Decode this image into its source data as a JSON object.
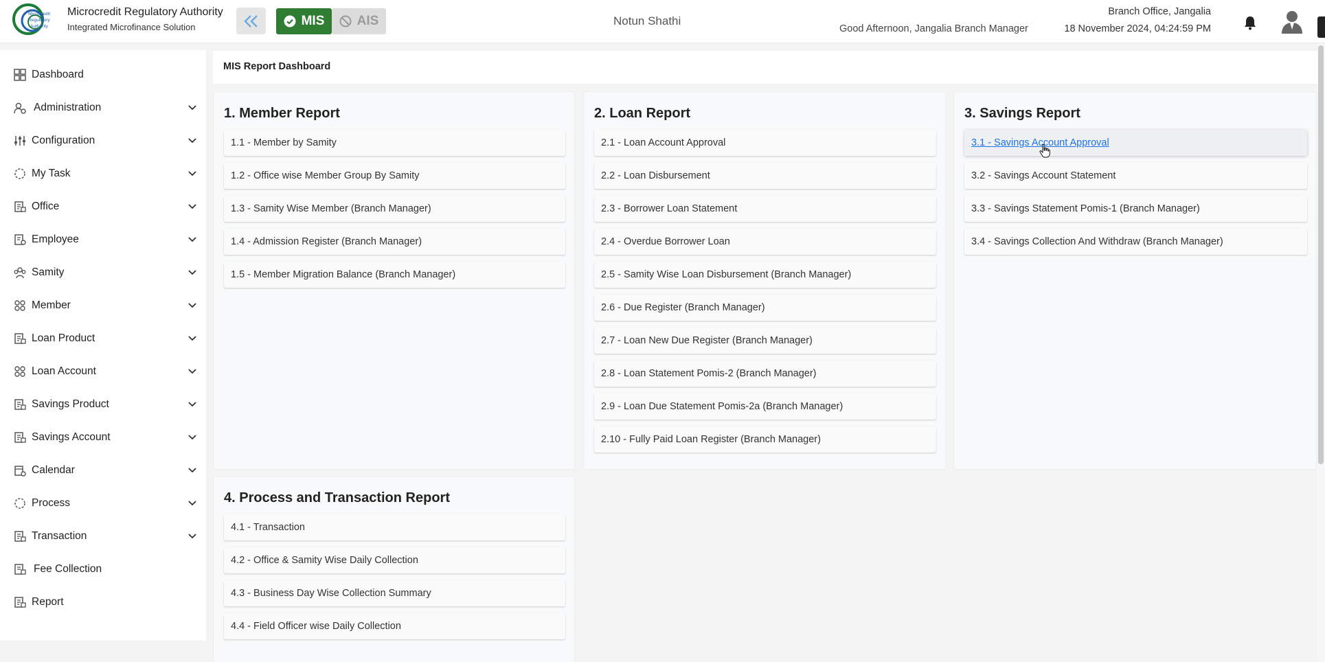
{
  "header": {
    "brand_title": "Microcredit Regulatory Authority",
    "brand_subtitle": "Integrated Microfinance Solution",
    "logo_text": "Microcredit Regulatory Authority",
    "mis_label": "MIS",
    "ais_label": "AIS",
    "org_name": "Notun Shathi",
    "greeting": "Good Afternoon, Jangalia Branch Manager",
    "branch": "Branch Office, Jangalia",
    "datetime": "18 November 2024, 04:24:59 PM"
  },
  "colors": {
    "mis_green": "#2e7d32",
    "link_blue": "#1a73e8",
    "logo_green": "#1b7c3a",
    "logo_blue": "#1f5fae"
  },
  "sidebar": {
    "items": [
      {
        "label": "Dashboard",
        "icon": "dashboard-icon",
        "expandable": false
      },
      {
        "label": "Administration",
        "icon": "admin-icon",
        "expandable": true
      },
      {
        "label": "Configuration",
        "icon": "sliders-icon",
        "expandable": true
      },
      {
        "label": "My Task",
        "icon": "task-icon",
        "expandable": true
      },
      {
        "label": "Office",
        "icon": "office-icon",
        "expandable": true
      },
      {
        "label": "Employee",
        "icon": "employee-icon",
        "expandable": true
      },
      {
        "label": "Samity",
        "icon": "samity-icon",
        "expandable": true
      },
      {
        "label": "Member",
        "icon": "member-icon",
        "expandable": true
      },
      {
        "label": "Loan Product",
        "icon": "loan-product-icon",
        "expandable": true
      },
      {
        "label": "Loan Account",
        "icon": "loan-account-icon",
        "expandable": true
      },
      {
        "label": "Savings Product",
        "icon": "savings-product-icon",
        "expandable": true
      },
      {
        "label": "Savings Account",
        "icon": "savings-account-icon",
        "expandable": true
      },
      {
        "label": "Calendar",
        "icon": "calendar-icon",
        "expandable": true
      },
      {
        "label": "Process",
        "icon": "process-icon",
        "expandable": true
      },
      {
        "label": "Transaction",
        "icon": "transaction-icon",
        "expandable": true
      },
      {
        "label": "Fee Collection",
        "icon": "fee-collection-icon",
        "expandable": false
      },
      {
        "label": "Report",
        "icon": "report-icon",
        "expandable": false
      }
    ]
  },
  "main": {
    "page_title": "MIS Report Dashboard",
    "sections": [
      {
        "title": "1. Member Report",
        "links": [
          "1.1 - Member by Samity",
          "1.2 - Office wise Member Group By Samity",
          "1.3 - Samity Wise Member (Branch Manager)",
          "1.4 - Admission Register (Branch Manager)",
          "1.5 - Member Migration Balance (Branch Manager)"
        ]
      },
      {
        "title": "2. Loan Report",
        "links": [
          "2.1 - Loan Account Approval",
          "2.2 - Loan Disbursement",
          "2.3 - Borrower Loan Statement",
          "2.4 - Overdue Borrower Loan",
          "2.5 - Samity Wise Loan Disbursement (Branch Manager)",
          "2.6 - Due Register (Branch Manager)",
          "2.7 - Loan New Due Register (Branch Manager)",
          "2.8 - Loan Statement Pomis-2 (Branch Manager)",
          "2.9 - Loan Due Statement Pomis-2a (Branch Manager)",
          "2.10 - Fully Paid Loan Register (Branch Manager)"
        ]
      },
      {
        "title": "3. Savings Report",
        "links": [
          "3.1 - Savings Account Approval",
          "3.2 - Savings Account Statement",
          "3.3 - Savings Statement Pomis-1 (Branch Manager)",
          "3.4 - Savings Collection And Withdraw (Branch Manager)"
        ]
      },
      {
        "title": "4. Process and Transaction Report",
        "links": [
          "4.1 - Transaction",
          "4.2 - Office & Samity Wise Daily Collection",
          "4.3 - Business Day Wise Collection Summary",
          "4.4 - Field Officer wise Daily Collection"
        ]
      }
    ]
  }
}
